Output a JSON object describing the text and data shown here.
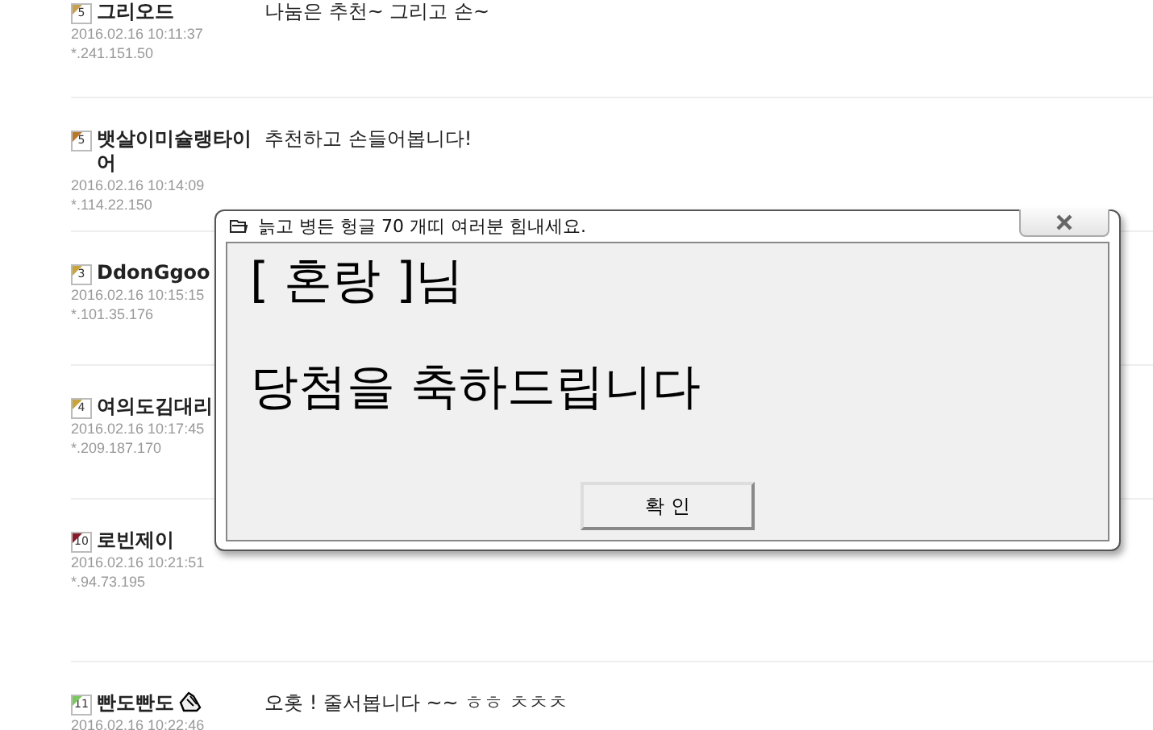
{
  "comments": [
    {
      "level": "5",
      "color": "#c8a050",
      "name": "그리오드",
      "datetime": "2016.02.16 10:11:37",
      "ip": "*.241.151.50",
      "message": "나눔은 추천~ 그리고 손~"
    },
    {
      "level": "5",
      "color": "#b8782a",
      "name": "뱃살이미슐랭타이어",
      "datetime": "2016.02.16 10:14:09",
      "ip": "*.114.22.150",
      "message": "추천하고 손들어봅니다!"
    },
    {
      "level": "3",
      "color": "#c8a43a",
      "name": "DdonGgoo",
      "datetime": "2016.02.16 10:15:15",
      "ip": "*.101.35.176"
    },
    {
      "level": "4",
      "color": "#c8a43a",
      "name": "여의도김대리",
      "datetime": "2016.02.16 10:17:45",
      "ip": "*.209.187.170"
    },
    {
      "level": "10",
      "color": "#8a1a2a",
      "name": "로빈제이",
      "datetime": "2016.02.16 10:21:51",
      "ip": "*.94.73.195"
    },
    {
      "level": "11",
      "color": "#7cc860",
      "name": "빤도빤도",
      "name_icon": true,
      "datetime": "2016.02.16 10:22:46",
      "message": "오홋 ! 줄서봅니다 ~~ ㅎㅎ ㅊㅊㅊ"
    }
  ],
  "dialog": {
    "title": "늙고 병든 헝글 70 개띠 여러분 힘내세요.",
    "line_1": "[ 혼랑 ]님",
    "line_2": "당첨을 축하드립니다",
    "button": "확 인"
  }
}
